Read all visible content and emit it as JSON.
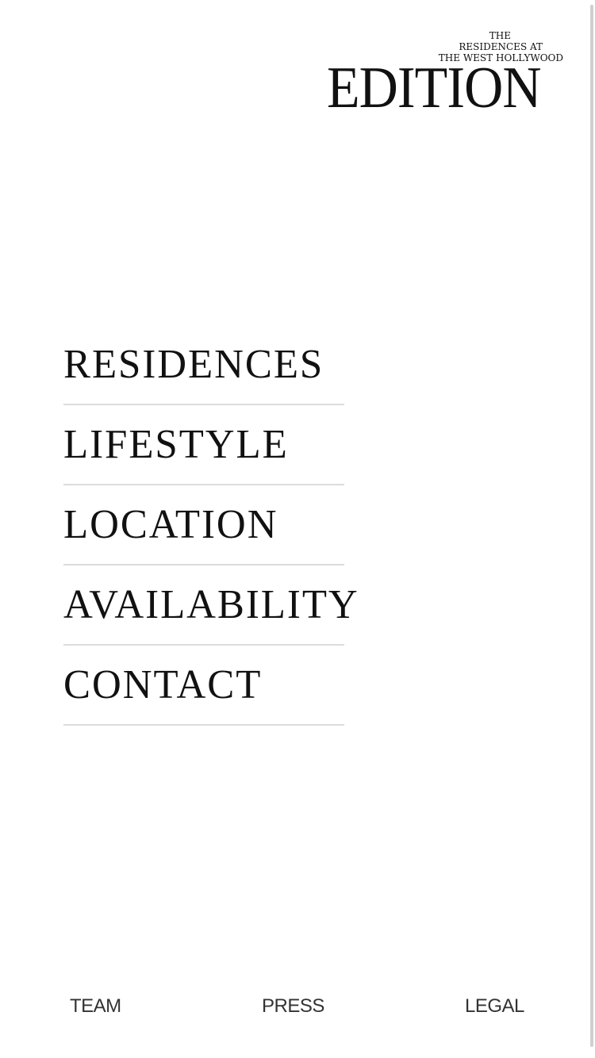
{
  "logo": {
    "line1": "THE",
    "line2": "RESIDENCES AT",
    "line3": "THE WEST HOLLYWOOD",
    "word": "EDITION"
  },
  "nav": {
    "items": [
      {
        "label": "RESIDENCES"
      },
      {
        "label": "LIFESTYLE"
      },
      {
        "label": "LOCATION"
      },
      {
        "label": "AVAILABILITY"
      },
      {
        "label": "CONTACT"
      }
    ]
  },
  "footer": {
    "team": "TEAM",
    "press": "PRESS",
    "legal": "LEGAL"
  }
}
